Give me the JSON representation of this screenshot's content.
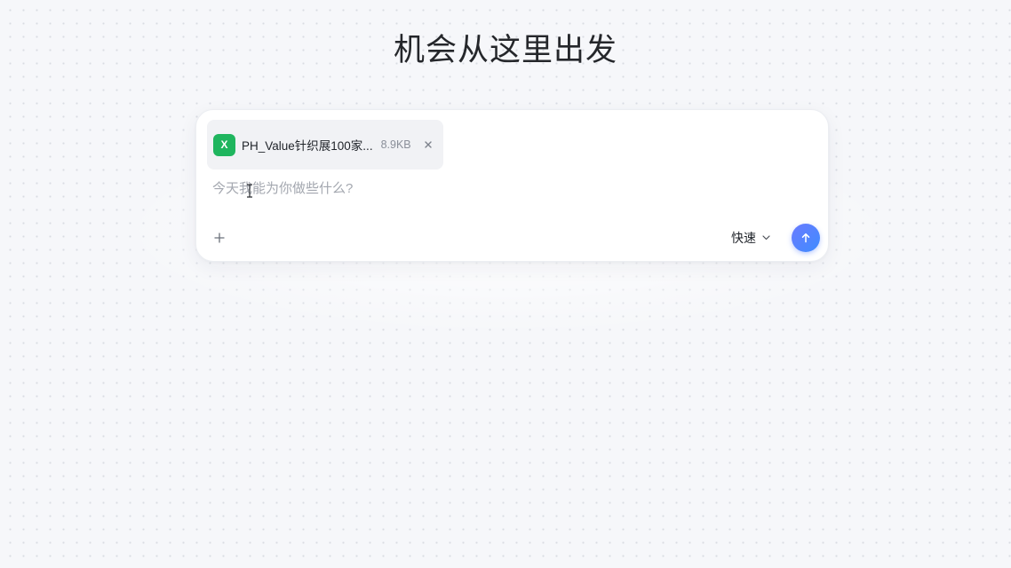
{
  "page": {
    "title": "机会从这里出发"
  },
  "composer": {
    "attachment": {
      "icon_label": "X",
      "icon": "spreadsheet-icon",
      "file_name": "PH_Value针织展100家...",
      "file_size": "8.9KB",
      "remove_icon": "close-icon"
    },
    "input": {
      "value": "",
      "placeholder": "今天我能为你做些什么?"
    },
    "add_icon": "plus-icon",
    "mode": {
      "selected": "快速",
      "icon": "chevron-down-icon"
    },
    "send_icon": "arrow-up-icon"
  },
  "colors": {
    "background": "#f6f7fa",
    "file_icon": "#1fb55e",
    "send_button": "#4f86ff"
  }
}
